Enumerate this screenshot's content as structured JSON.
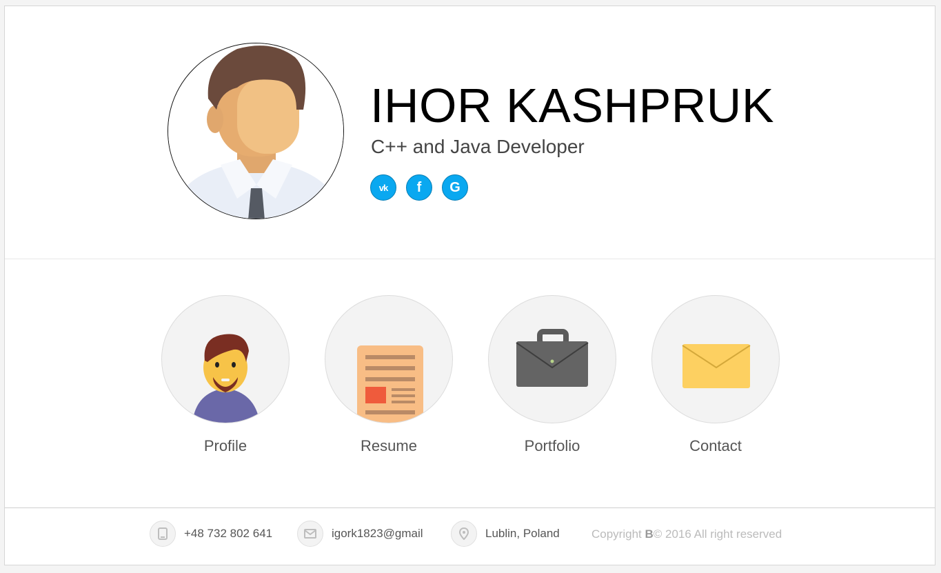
{
  "profile": {
    "name": "IHOR KASHPRUK",
    "role": "C++ and Java Developer"
  },
  "socials": [
    {
      "id": "vk",
      "label": "vk",
      "icon": "vk-icon"
    },
    {
      "id": "facebook",
      "label": "f",
      "icon": "facebook-icon"
    },
    {
      "id": "google",
      "label": "G",
      "icon": "google-icon"
    }
  ],
  "nav": {
    "profile": "Profile",
    "resume": "Resume",
    "portfolio": "Portfolio",
    "contact": "Contact"
  },
  "footer": {
    "phone": "+48 732 802 641",
    "email": "igork1823@gmail",
    "location": "Lublin, Poland",
    "copyright_prefix": "Copyright ",
    "copyright_brand": "B",
    "copyright_suffix": "© 2016 All right reserved"
  },
  "colors": {
    "accent": "#0aa8f0",
    "tile_bg": "#f3f3f3",
    "name_color": "#000000"
  }
}
